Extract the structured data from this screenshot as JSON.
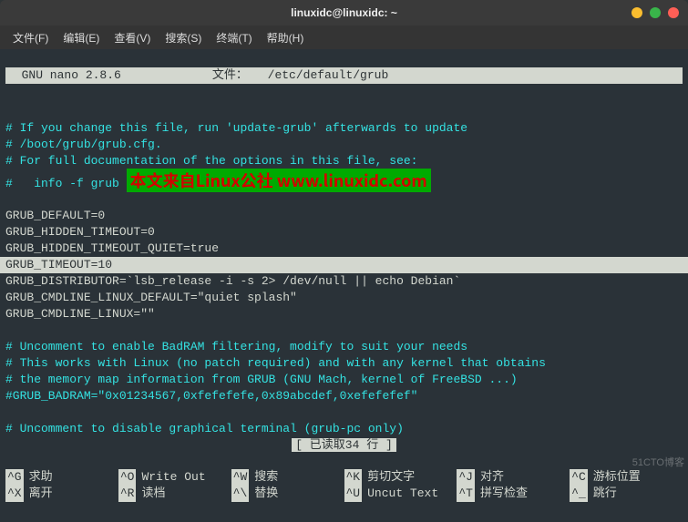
{
  "window": {
    "title": "linuxidc@linuxidc: ~"
  },
  "menubar": {
    "items": [
      "文件(F)",
      "编辑(E)",
      "查看(V)",
      "搜索(S)",
      "终端(T)",
      "帮助(H)"
    ]
  },
  "nano": {
    "version": "  GNU nano 2.8.6",
    "file_label": "文件：",
    "file_path": " /etc/default/grub"
  },
  "file": {
    "c1": "# If you change this file, run 'update-grub' afterwards to update",
    "c2": "# /boot/grub/grub.cfg.",
    "c3": "# For full documentation of the options in this file, see:",
    "c4_prefix": "#   info -f grub ",
    "watermark": "本文来自Linux公社 www.linuxidc.com",
    "l1": "GRUB_DEFAULT=0",
    "l2": "GRUB_HIDDEN_TIMEOUT=0",
    "l3": "GRUB_HIDDEN_TIMEOUT_QUIET=true",
    "l4": "GRUB_TIMEOUT=10",
    "l5": "GRUB_DISTRIBUTOR=`lsb_release -i -s 2> /dev/null || echo Debian`",
    "l6": "GRUB_CMDLINE_LINUX_DEFAULT=\"quiet splash\"",
    "l7": "GRUB_CMDLINE_LINUX=\"\"",
    "c5": "# Uncomment to enable BadRAM filtering, modify to suit your needs",
    "c6": "# This works with Linux (no patch required) and with any kernel that obtains",
    "c7": "# the memory map information from GRUB (GNU Mach, kernel of FreeBSD ...)",
    "c8": "#GRUB_BADRAM=\"0x01234567,0xfefefefe,0x89abcdef,0xefefefef\"",
    "c9": "# Uncomment to disable graphical terminal (grub-pc only)"
  },
  "status": "[ 已读取34 行 ]",
  "shortcuts": [
    {
      "key": "^G",
      "label": "求助"
    },
    {
      "key": "^O",
      "label": "Write Out"
    },
    {
      "key": "^W",
      "label": "搜索"
    },
    {
      "key": "^K",
      "label": "剪切文字"
    },
    {
      "key": "^J",
      "label": "对齐"
    },
    {
      "key": "^C",
      "label": "游标位置"
    },
    {
      "key": "^X",
      "label": "离开"
    },
    {
      "key": "^R",
      "label": "读档"
    },
    {
      "key": "^\\",
      "label": "替换"
    },
    {
      "key": "^U",
      "label": "Uncut Text"
    },
    {
      "key": "^T",
      "label": "拼写检查"
    },
    {
      "key": "^_",
      "label": "跳行"
    }
  ],
  "blog_watermark": "51CTO博客"
}
